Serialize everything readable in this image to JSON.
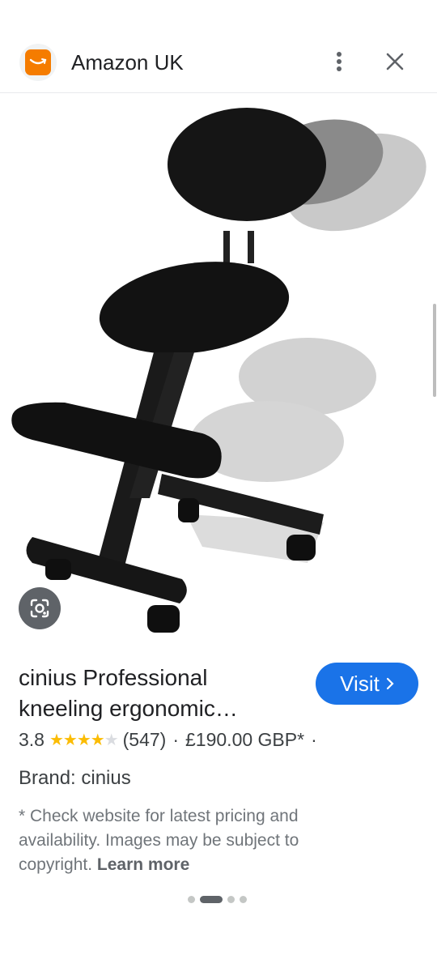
{
  "header": {
    "site_name": "Amazon UK",
    "logo_icon": "amazon-smile-icon",
    "menu_icon": "more-vert-icon",
    "close_icon": "close-icon"
  },
  "product": {
    "title": "cinius Professional kneeling ergonomic…",
    "visit_label": "Visit",
    "rating": "3.8",
    "stars": 3.8,
    "review_count": "(547)",
    "separator": "·",
    "price": "£190.00 GBP*",
    "trailing_separator": "·",
    "brand": "Brand: cinius",
    "disclaimer": "* Check website for latest pricing and availability. Images may be subject to copyright.",
    "learn_more": "Learn more"
  },
  "carousel": {
    "total": 4,
    "active_index": 1
  },
  "colors": {
    "accent": "#1a73e8",
    "star": "#fbbc04",
    "logo": "#f57c00"
  }
}
